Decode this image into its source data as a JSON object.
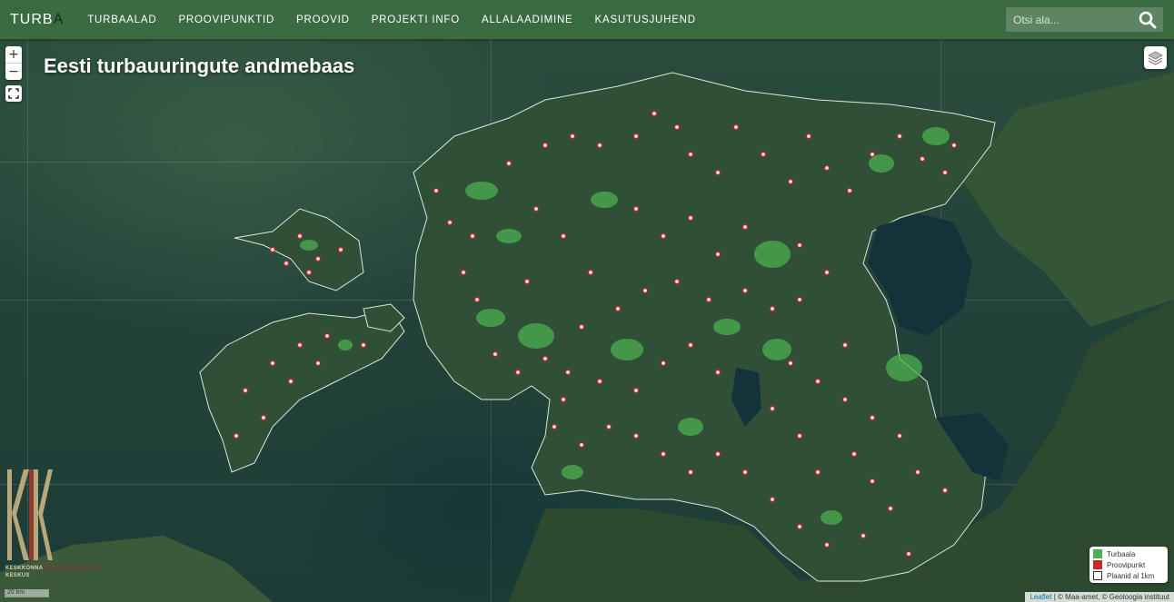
{
  "brand": {
    "name": "TURB",
    "accent": "A"
  },
  "nav": {
    "items": [
      {
        "label": "TURBAALAD"
      },
      {
        "label": "PROOVIPUNKTID"
      },
      {
        "label": "PROOVID"
      },
      {
        "label": "PROJEKTI INFO"
      },
      {
        "label": "ALLALAADIMINE"
      },
      {
        "label": "KASUTUSJUHEND"
      }
    ]
  },
  "search": {
    "placeholder": "Otsi ala...",
    "icon": "search-icon"
  },
  "map": {
    "title": "Eesti turbauuringute andmebaas",
    "zoom_in": "+",
    "zoom_out": "−",
    "fullscreen_icon": "fullscreen-icon",
    "layers_icon": "layers-icon"
  },
  "logo": {
    "line1_a": "KESKKONNA",
    "line1_b": "INVESTEERINGUTE",
    "line2": "KESKUS"
  },
  "scale": {
    "label": "20 km"
  },
  "legend": {
    "items": [
      {
        "label": "Turbaala",
        "color": "#4caf50"
      },
      {
        "label": "Proovipunkt",
        "color": "#c62828"
      },
      {
        "label": "Plaanid al 1km",
        "color": "#ffffff"
      }
    ]
  },
  "attribution": {
    "leaflet": "Leaflet",
    "rest": " | © Maa-amet, © Geoloogia instituut"
  },
  "colors": {
    "navbar": "#3c6e41",
    "land": "#2f5037",
    "peat": "#4caf50",
    "point": "#e57373"
  }
}
